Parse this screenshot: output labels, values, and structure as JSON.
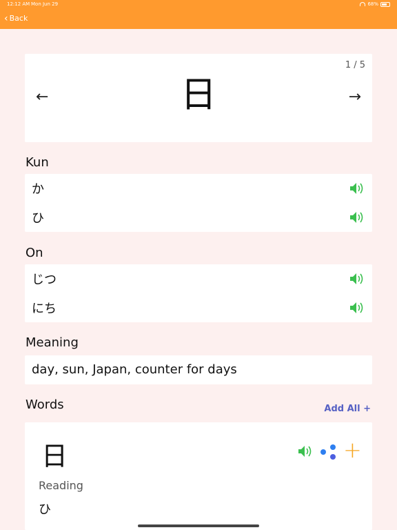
{
  "status": {
    "time": "12:12 AM",
    "date": "Mon Jun 29",
    "battery": "68%"
  },
  "nav": {
    "back_label": "Back"
  },
  "kanji": {
    "character": "日",
    "counter": "1 / 5",
    "prev": "←",
    "next": "→"
  },
  "sections": {
    "kun_title": "Kun",
    "on_title": "On",
    "meaning_title": "Meaning",
    "words_title": "Words"
  },
  "kun": [
    "か",
    "ひ"
  ],
  "on": [
    "じつ",
    "にち"
  ],
  "meaning": "day, sun, Japan, counter for days",
  "words": {
    "add_all": "Add All +",
    "items": [
      {
        "kanji": "日",
        "reading_label": "Reading",
        "reading": "ひ"
      }
    ]
  },
  "colors": {
    "accent": "#ff9a2e",
    "speaker": "#3bbf4f",
    "link": "#5661c4",
    "add": "#f5a623",
    "dots": "#2e7ff0"
  }
}
